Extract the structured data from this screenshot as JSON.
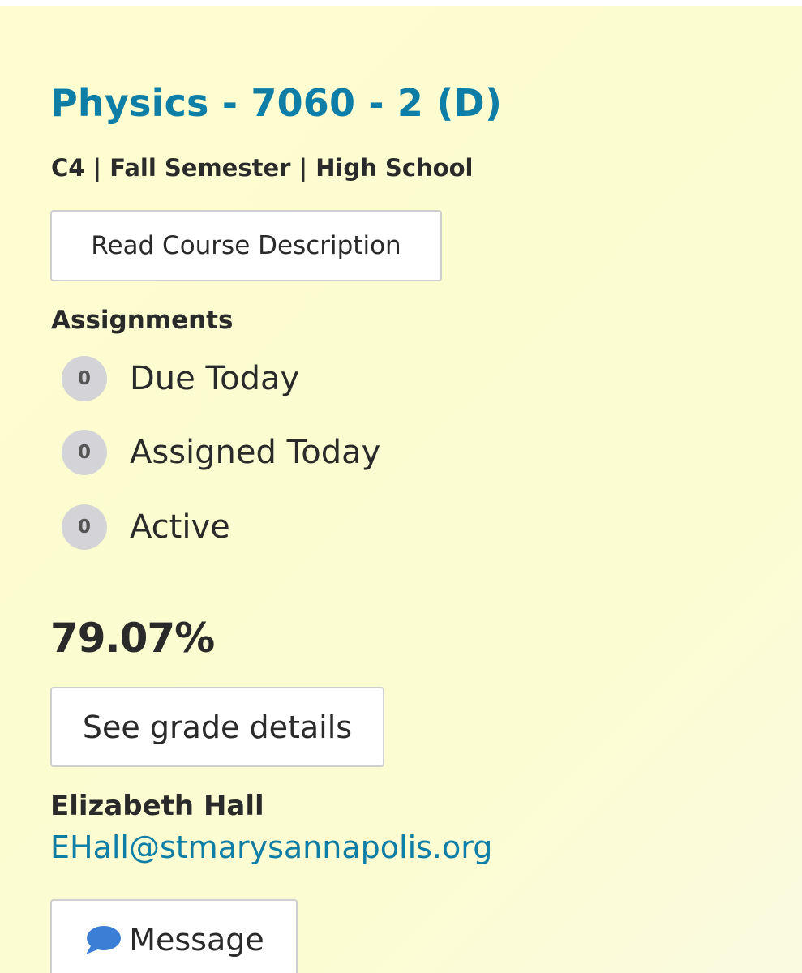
{
  "course": {
    "title": "Physics - 7060 - 2 (D)",
    "meta": "C4 | Fall Semester | High School",
    "description_button": "Read Course Description"
  },
  "assignments": {
    "heading": "Assignments",
    "items": [
      {
        "count": "0",
        "label": "Due Today"
      },
      {
        "count": "0",
        "label": "Assigned Today"
      },
      {
        "count": "0",
        "label": "Active"
      }
    ]
  },
  "grade": {
    "value": "79.07%",
    "details_button": "See grade details"
  },
  "teacher": {
    "name": "Elizabeth Hall",
    "email": "EHall@stmarysannapolis.org",
    "message_button": "Message",
    "message_icon": "speech-bubble-icon"
  },
  "colors": {
    "background": "#fcfcd2",
    "accent": "#0f7ea6",
    "text": "#2a2a2a",
    "badge": "#d4d4d8",
    "message_icon": "#3a7fd5"
  }
}
